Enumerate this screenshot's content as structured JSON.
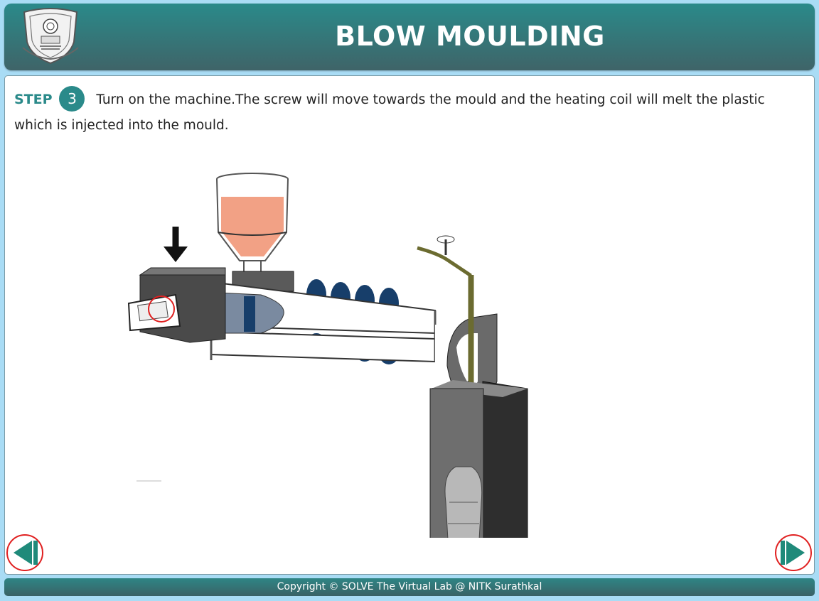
{
  "header": {
    "title": "BLOW MOULDING",
    "logo_icon": "nitk-crest-logo"
  },
  "step": {
    "label": "STEP",
    "number": "3",
    "instruction": "Turn on the machine.The screw will move towards the mould and the heating coil will melt the plastic which is injected into the mould."
  },
  "navigation": {
    "prev_icon": "previous-arrow-icon",
    "next_icon": "next-arrow-icon"
  },
  "footer": {
    "copyright": "Copyright © SOLVE The Virtual Lab @ NITK Surathkal"
  },
  "colors": {
    "header_teal": "#2a8a8a",
    "background": "#a9dcf5",
    "highlight_red": "#e02020"
  }
}
